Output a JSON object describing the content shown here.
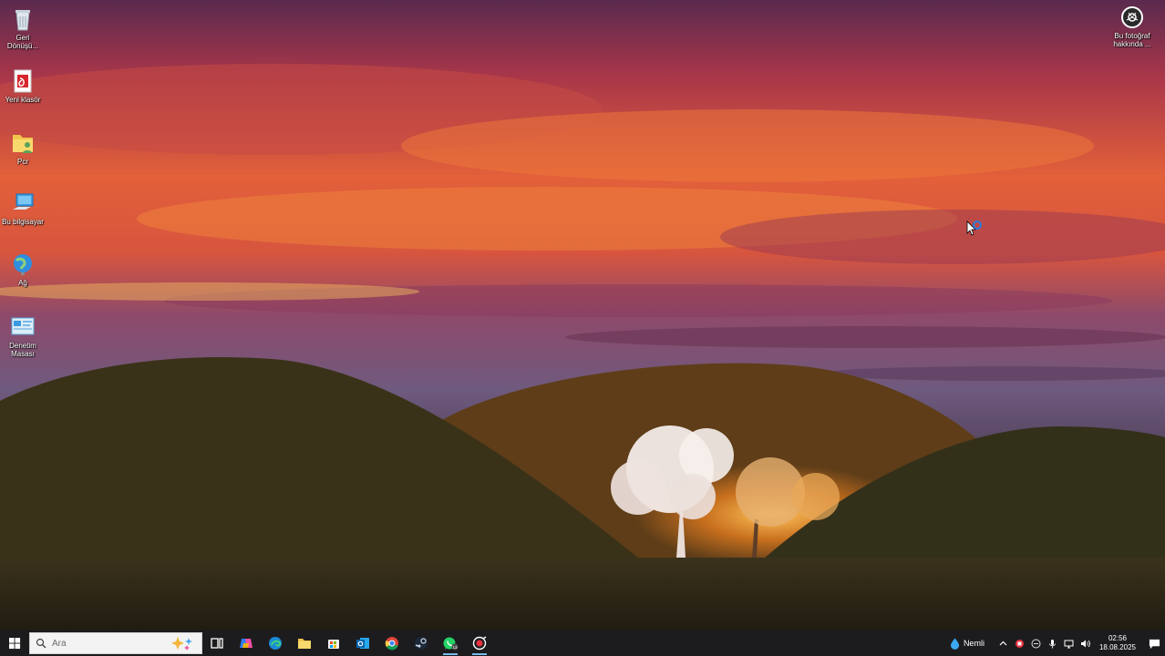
{
  "desktop": {
    "icons": [
      {
        "label": "Geri Dönüşü...",
        "icon": "recycle-bin-icon"
      },
      {
        "label": "Yeni klasör",
        "icon": "pdf-folder-icon"
      },
      {
        "label": "Pcr",
        "icon": "folder-user-icon"
      },
      {
        "label": "Bu bilgisayar",
        "icon": "computer-icon"
      },
      {
        "label": "Ağ",
        "icon": "network-icon"
      },
      {
        "label": "Denetim Masası",
        "icon": "control-panel-icon"
      }
    ],
    "photo_info": {
      "label": "Bu fotoğraf hakkında ...",
      "icon": "camera-info-icon"
    }
  },
  "taskbar": {
    "search_placeholder": "Ara",
    "apps": [
      {
        "name": "task-view",
        "icon": "task-view-icon"
      },
      {
        "name": "copilot",
        "icon": "copilot-icon"
      },
      {
        "name": "edge",
        "icon": "edge-icon"
      },
      {
        "name": "file-explorer",
        "icon": "folder-icon"
      },
      {
        "name": "store",
        "icon": "store-icon"
      },
      {
        "name": "outlook",
        "icon": "outlook-icon"
      },
      {
        "name": "chrome",
        "icon": "chrome-icon"
      },
      {
        "name": "steam",
        "icon": "steam-icon"
      },
      {
        "name": "whatsapp",
        "icon": "whatsapp-icon",
        "badge": "13"
      },
      {
        "name": "snipping",
        "icon": "snipping-icon"
      }
    ],
    "weather_text": "Nemli",
    "clock_time": "02:56",
    "clock_date": "18.08.2025"
  },
  "colors": {
    "taskbar_bg": "#1c1c1f",
    "accent": "#76b9ed"
  }
}
